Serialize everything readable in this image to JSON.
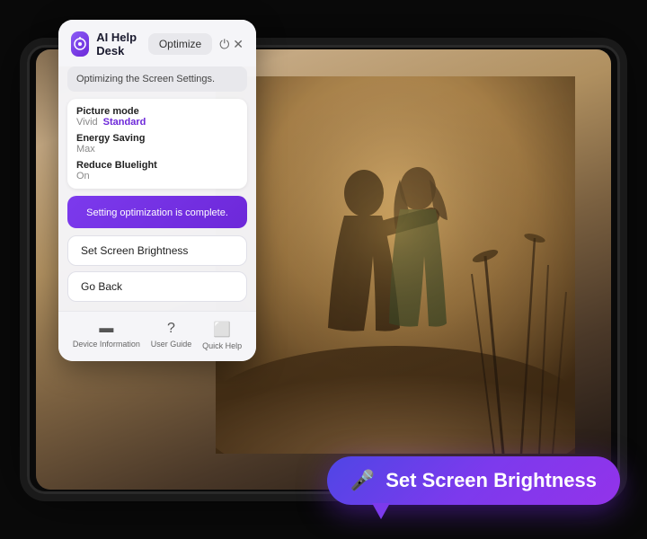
{
  "app": {
    "title": "AI Help Desk",
    "background": "#0a0a0a"
  },
  "panel": {
    "title": "AI Help Desk",
    "optimize_btn": "Optimize",
    "status_text": "Optimizing the Screen Settings.",
    "settings": [
      {
        "label": "Picture mode",
        "values": [
          {
            "text": "Vivid",
            "active": false
          },
          {
            "text": "Standard",
            "active": true
          }
        ]
      },
      {
        "label": "Energy Saving",
        "values": [
          {
            "text": "Max",
            "active": false
          }
        ]
      },
      {
        "label": "Reduce Bluelight",
        "values": [
          {
            "text": "On",
            "active": false
          }
        ]
      }
    ],
    "complete_text": "Setting optimization is complete.",
    "buttons": [
      {
        "label": "Set Screen Brightness"
      },
      {
        "label": "Go Back"
      }
    ],
    "footer_items": [
      {
        "icon": "📟",
        "label": "Device Information"
      },
      {
        "icon": "❓",
        "label": "User Guide"
      },
      {
        "icon": "📋",
        "label": "Quick Help"
      }
    ]
  },
  "voice_bubble": {
    "mic_icon": "🎤",
    "text": "Set Screen Brightness"
  }
}
